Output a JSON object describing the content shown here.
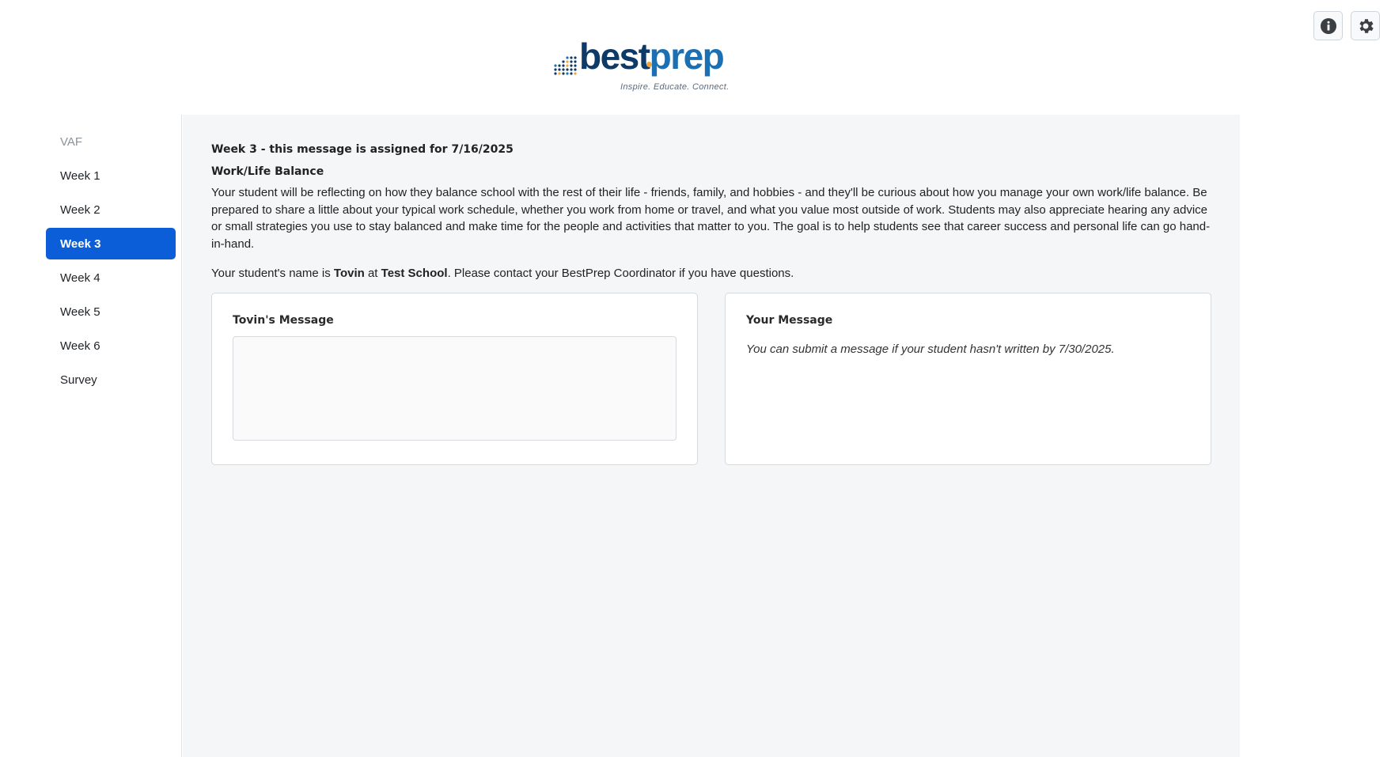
{
  "header": {
    "info_icon": "info-icon",
    "settings_icon": "gear-icon"
  },
  "logo": {
    "word_best": "best",
    "word_prep": "prep",
    "tagline": "Inspire. Educate. Connect.",
    "colors": {
      "navy": "#0d3a66",
      "blue": "#1b6fb3",
      "orange": "#f2a33a"
    }
  },
  "sidebar": {
    "items": [
      {
        "label": "VAF",
        "state": "muted"
      },
      {
        "label": "Week 1",
        "state": "normal"
      },
      {
        "label": "Week 2",
        "state": "normal"
      },
      {
        "label": "Week 3",
        "state": "active"
      },
      {
        "label": "Week 4",
        "state": "normal"
      },
      {
        "label": "Week 5",
        "state": "normal"
      },
      {
        "label": "Week 6",
        "state": "normal"
      },
      {
        "label": "Survey",
        "state": "normal"
      }
    ],
    "active_color": "#0b5ed7"
  },
  "main": {
    "assignment_heading": "Week 3 - this message is assigned for 7/16/2025",
    "topic_heading": "Work/Life Balance",
    "description": "Your student will be reflecting on how they balance school with the rest of their life - friends, family, and hobbies - and they'll be curious about how you manage your own work/life balance. Be prepared to share a little about your typical work schedule, whether you work from home or travel, and what you value most outside of work. Students may also appreciate hearing any advice or small strategies you use to stay balanced and make time for the people and activities that matter to you. The goal is to help students see that career success and personal life can go hand-in-hand.",
    "student_line": {
      "prefix": "Your student's name is ",
      "student_name": "Tovin",
      "middle": " at ",
      "school": "Test School",
      "suffix": ". Please contact your BestPrep Coordinator if you have questions."
    },
    "student_card": {
      "title": "Tovin's Message",
      "message": ""
    },
    "your_card": {
      "title": "Your Message",
      "hint": "You can submit a message if your student hasn't written by 7/30/2025."
    }
  }
}
